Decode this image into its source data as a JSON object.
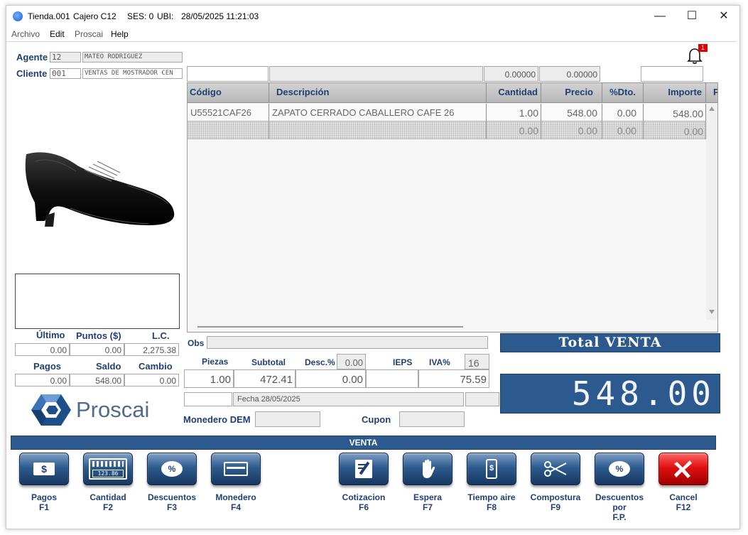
{
  "titlebar": {
    "store": "Tienda.001",
    "cashier": "Cajero C12",
    "session": "SES: 0",
    "ubi": "UBI:",
    "datetime": "28/05/2025 11:21:03",
    "minimize": "—",
    "maximize": "☐",
    "close": "✕"
  },
  "menu": [
    "Archivo",
    "Edit",
    "Proscai",
    "Help"
  ],
  "notification": {
    "count": "1"
  },
  "agent": {
    "label": "Agente",
    "code": "12",
    "name": "MATEO RODRIGUEZ"
  },
  "client": {
    "label": "Cliente",
    "code": "001",
    "name": "VENTAS DE MOSTRADOR CEN"
  },
  "topfields": {
    "v1": "0.00000",
    "v2": "0.00000"
  },
  "grid": {
    "headers": [
      "Código",
      "Descripción",
      "Cantidad",
      "Precio",
      "%Dto.",
      "Importe",
      "P"
    ],
    "rows": [
      [
        "U55521CAF26",
        "ZAPATO CERRADO CABALLERO CAFE 26",
        "1.00",
        "548.00",
        "0.00",
        "548.00"
      ],
      [
        "",
        "",
        "0.00",
        "0.00",
        "0.00",
        "0.00"
      ]
    ]
  },
  "stats1": {
    "h1": "Último",
    "h2": "Puntos ($)",
    "h3": "L.C.",
    "v1": "0.00",
    "v2": "0.00",
    "v3": "2,275.38"
  },
  "stats2": {
    "h1": "Pagos",
    "h2": "Saldo",
    "h3": "Cambio",
    "v1": "0.00",
    "v2": "548.00",
    "v3": "0.00"
  },
  "logo": {
    "text": "Proscai"
  },
  "obs": {
    "label": "Obs"
  },
  "summary": {
    "piezas_label": "Piezas",
    "subtotal_label": "Subtotal",
    "desc_label": "Desc.%",
    "desc_pct": "0.00",
    "ieps_label": "IEPS",
    "iva_label": "IVA%",
    "iva_pct": "16",
    "piezas": "1.00",
    "subtotal": "472.41",
    "desc": "0.00",
    "ieps": "",
    "iva": "75.59"
  },
  "fecha": "Fecha 28/05/2025",
  "monedero": {
    "label": "Monedero DEM"
  },
  "cupon": {
    "label": "Cupon"
  },
  "total": {
    "title": "Total VENTA",
    "value": "548.00"
  },
  "venta_bar": "VENTA",
  "fkeys": [
    {
      "label": "Pagos",
      "key": "F1"
    },
    {
      "label": "Cantidad",
      "key": "F2",
      "display": "123.86"
    },
    {
      "label": "Descuentos",
      "key": "F3",
      "glyph": "%"
    },
    {
      "label": "Monedero",
      "key": "F4"
    },
    {
      "label": "Cotizacion",
      "key": "F6"
    },
    {
      "label": "Espera",
      "key": "F7"
    },
    {
      "label": "Tiempo aire",
      "key": "F8"
    },
    {
      "label": "Compostura",
      "key": "F9"
    },
    {
      "label": "Descuentos por",
      "key": "F.P.",
      "glyph": "%"
    },
    {
      "label": "Cancel",
      "key": "F12"
    }
  ],
  "colors": {
    "accent": "#2c5a8f",
    "label": "#1f3f73",
    "cancel": "#e01010"
  }
}
